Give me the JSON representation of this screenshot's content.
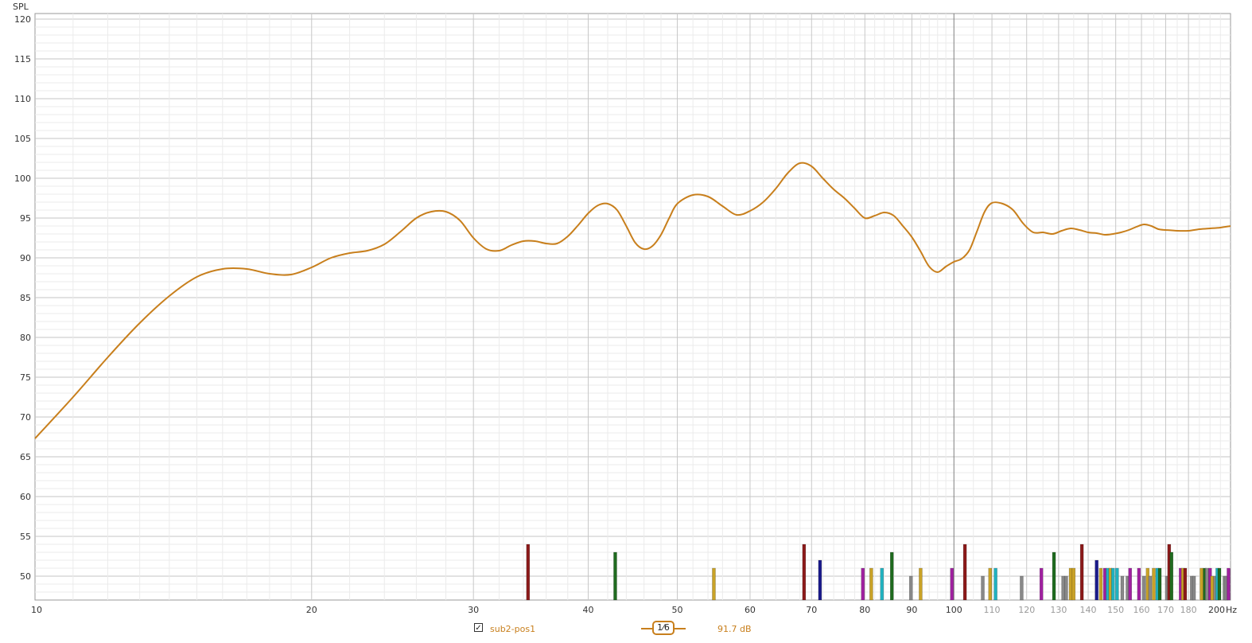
{
  "chart_data": {
    "type": "line",
    "ylabel": "SPL",
    "xunit": "Hz",
    "xscale": "log",
    "xlim": [
      10,
      200
    ],
    "ylim": [
      47,
      121
    ],
    "grid": true,
    "x_ticks": [
      10,
      20,
      30,
      40,
      50,
      60,
      70,
      80,
      90,
      100,
      110,
      120,
      130,
      140,
      150,
      160,
      170,
      180,
      200
    ],
    "x_ticks_dim": [
      110,
      120,
      130,
      140,
      150,
      160,
      170,
      180
    ],
    "y_ticks": [
      50,
      55,
      60,
      65,
      70,
      75,
      80,
      85,
      90,
      95,
      100,
      105,
      110,
      115,
      120
    ],
    "series": [
      {
        "name": "sub2-pos1",
        "color": "#c87f1c",
        "x": [
          10,
          11,
          12,
          13,
          14,
          15,
          16,
          17,
          18,
          19,
          20,
          21,
          22,
          23,
          24,
          25,
          26,
          27,
          28,
          29,
          30,
          31,
          32,
          33,
          34,
          35,
          36,
          37,
          38,
          39,
          40,
          41,
          42,
          43,
          44,
          45,
          46,
          47,
          48,
          49,
          50,
          52,
          54,
          56,
          58,
          60,
          62,
          64,
          66,
          68,
          70,
          72,
          74,
          76,
          78,
          80,
          82,
          84,
          86,
          88,
          90,
          92,
          94,
          96,
          98,
          100,
          102,
          104,
          106,
          108,
          110,
          113,
          116,
          119,
          122,
          125,
          128,
          131,
          134,
          137,
          140,
          143,
          146,
          149,
          152,
          155,
          158,
          161,
          164,
          167,
          170,
          175,
          180,
          185,
          190,
          195,
          200
        ],
        "y": [
          67.3,
          72.5,
          77.5,
          81.8,
          85.2,
          87.6,
          88.6,
          88.6,
          88.0,
          87.9,
          88.8,
          90.0,
          90.6,
          90.9,
          91.7,
          93.3,
          95.0,
          95.8,
          95.8,
          94.7,
          92.5,
          91.1,
          90.9,
          91.6,
          92.1,
          92.1,
          91.8,
          91.8,
          92.7,
          94.1,
          95.6,
          96.6,
          96.8,
          96.0,
          94.0,
          91.9,
          91.1,
          91.5,
          92.9,
          95.0,
          96.8,
          97.9,
          97.7,
          96.5,
          95.4,
          95.9,
          97.0,
          98.7,
          100.7,
          101.9,
          101.5,
          100.0,
          98.6,
          97.5,
          96.2,
          95.0,
          95.3,
          95.7,
          95.3,
          94.0,
          92.6,
          90.8,
          88.9,
          88.2,
          88.9,
          89.5,
          89.9,
          91.0,
          93.4,
          95.8,
          96.9,
          96.8,
          96.0,
          94.3,
          93.2,
          93.2,
          93.0,
          93.4,
          93.7,
          93.5,
          93.2,
          93.1,
          92.9,
          93.0,
          93.2,
          93.5,
          93.9,
          94.2,
          94.0,
          93.6,
          93.5,
          93.4,
          93.4,
          93.6,
          93.7,
          93.8,
          94.0
        ]
      }
    ],
    "markers": [
      {
        "f": 34.4,
        "level": 54,
        "color": "#8b1a1a"
      },
      {
        "f": 42.8,
        "level": 53,
        "color": "#1f6b1f"
      },
      {
        "f": 54.8,
        "level": 51,
        "color": "#c9a227"
      },
      {
        "f": 68.7,
        "level": 54,
        "color": "#8b1a1a"
      },
      {
        "f": 71.5,
        "level": 52,
        "color": "#1a1a8b"
      },
      {
        "f": 79.6,
        "level": 51,
        "color": "#a020a0"
      },
      {
        "f": 81.3,
        "level": 51,
        "color": "#c9a227"
      },
      {
        "f": 83.5,
        "level": 51,
        "color": "#20b2c0"
      },
      {
        "f": 85.6,
        "level": 53,
        "color": "#1f6b1f"
      },
      {
        "f": 89.8,
        "level": 50,
        "color": "#888888"
      },
      {
        "f": 92.0,
        "level": 51,
        "color": "#c9a227"
      },
      {
        "f": 99.5,
        "level": 51,
        "color": "#a020a0"
      },
      {
        "f": 102.8,
        "level": 54,
        "color": "#8b1a1a"
      },
      {
        "f": 107.5,
        "level": 50,
        "color": "#888888"
      },
      {
        "f": 109.5,
        "level": 51,
        "color": "#c9a227"
      },
      {
        "f": 111.0,
        "level": 51,
        "color": "#20b2c0"
      },
      {
        "f": 118.5,
        "level": 50,
        "color": "#888888"
      },
      {
        "f": 124.5,
        "level": 51,
        "color": "#a020a0"
      },
      {
        "f": 128.5,
        "level": 53,
        "color": "#1f6b1f"
      },
      {
        "f": 131.5,
        "level": 50,
        "color": "#888888"
      },
      {
        "f": 132.5,
        "level": 50,
        "color": "#888888"
      },
      {
        "f": 134.0,
        "level": 51,
        "color": "#c9a227"
      },
      {
        "f": 135.0,
        "level": 51,
        "color": "#c9a227"
      },
      {
        "f": 137.8,
        "level": 54,
        "color": "#8b1a1a"
      },
      {
        "f": 143.0,
        "level": 52,
        "color": "#1a1a8b"
      },
      {
        "f": 144.5,
        "level": 51,
        "color": "#c9a227"
      },
      {
        "f": 146.0,
        "level": 51,
        "color": "#a020a0"
      },
      {
        "f": 147.0,
        "level": 51,
        "color": "#20b2c0"
      },
      {
        "f": 148.0,
        "level": 51,
        "color": "#c9a227"
      },
      {
        "f": 149.0,
        "level": 51,
        "color": "#20b2c0"
      },
      {
        "f": 150.5,
        "level": 51,
        "color": "#20b2c0"
      },
      {
        "f": 152.5,
        "level": 50,
        "color": "#888888"
      },
      {
        "f": 154.5,
        "level": 50,
        "color": "#888888"
      },
      {
        "f": 155.5,
        "level": 51,
        "color": "#a020a0"
      },
      {
        "f": 159.0,
        "level": 51,
        "color": "#a020a0"
      },
      {
        "f": 161.0,
        "level": 50,
        "color": "#888888"
      },
      {
        "f": 162.5,
        "level": 51,
        "color": "#c9a227"
      },
      {
        "f": 163.5,
        "level": 50,
        "color": "#888888"
      },
      {
        "f": 165.0,
        "level": 51,
        "color": "#c9a227"
      },
      {
        "f": 166.5,
        "level": 51,
        "color": "#20b2c0"
      },
      {
        "f": 167.5,
        "level": 51,
        "color": "#1f6b1f"
      },
      {
        "f": 170.5,
        "level": 50,
        "color": "#888888"
      },
      {
        "f": 171.5,
        "level": 54,
        "color": "#8b1a1a"
      },
      {
        "f": 172.5,
        "level": 53,
        "color": "#1f6b1f"
      },
      {
        "f": 176.5,
        "level": 51,
        "color": "#a020a0"
      },
      {
        "f": 177.5,
        "level": 51,
        "color": "#c9a227"
      },
      {
        "f": 178.5,
        "level": 51,
        "color": "#8b1a1a"
      },
      {
        "f": 181.5,
        "level": 50,
        "color": "#888888"
      },
      {
        "f": 182.5,
        "level": 50,
        "color": "#888888"
      },
      {
        "f": 186.0,
        "level": 51,
        "color": "#c9a227"
      },
      {
        "f": 187.5,
        "level": 51,
        "color": "#1f6b1f"
      },
      {
        "f": 188.5,
        "level": 51,
        "color": "#888888"
      },
      {
        "f": 190.0,
        "level": 51,
        "color": "#a020a0"
      },
      {
        "f": 191.0,
        "level": 50,
        "color": "#c9a227"
      },
      {
        "f": 192.5,
        "level": 50,
        "color": "#888888"
      },
      {
        "f": 193.5,
        "level": 51,
        "color": "#20b2c0"
      },
      {
        "f": 194.5,
        "level": 51,
        "color": "#1f6b1f"
      },
      {
        "f": 197.0,
        "level": 50,
        "color": "#888888"
      },
      {
        "f": 198.0,
        "level": 50,
        "color": "#888888"
      },
      {
        "f": 199.0,
        "level": 51,
        "color": "#a020a0"
      }
    ]
  },
  "legend": {
    "checked": true,
    "checkmark": "✓",
    "series_name": "sub2-pos1",
    "smoothing": "1⁄6",
    "value": "91.7 dB"
  }
}
